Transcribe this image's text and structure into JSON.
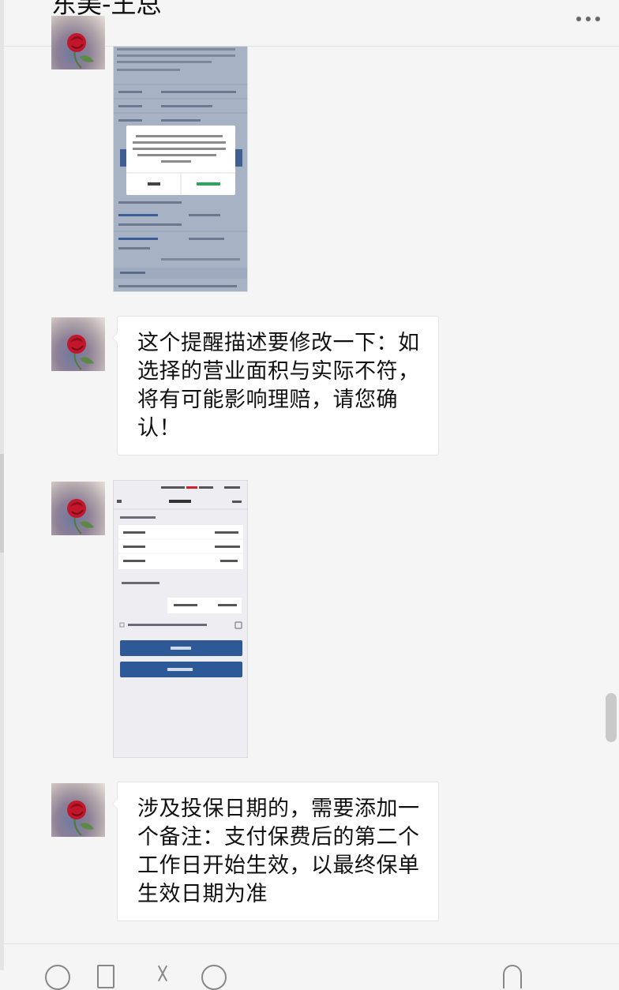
{
  "header": {
    "title": "东美-王总",
    "more_icon": "more-dots-icon"
  },
  "messages": [
    {
      "type": "image",
      "sender_avatar": "rose-avatar",
      "description_icon": "screenshot-thumbnail"
    },
    {
      "type": "text",
      "sender_avatar": "rose-avatar",
      "text": "这个提醒描述要修改一下：如选择的营业面积与实际不符，将有可能影响理赔，请您确认！"
    },
    {
      "type": "image",
      "sender_avatar": "rose-avatar",
      "description_icon": "screenshot-thumbnail"
    },
    {
      "type": "text",
      "sender_avatar": "rose-avatar",
      "text": "涉及投保日期的，需要添加一个备注：支付保费后的第二个工作日开始生效，以最终保单生效日期为准"
    }
  ],
  "toolbar": {
    "icons": [
      "emoji-icon",
      "file-icon",
      "scissors-icon",
      "chat-history-icon",
      "call-icon"
    ]
  },
  "colors": {
    "background": "#f5f5f5",
    "bubble": "#ffffff",
    "screenshot_button_blue": "#2d5a97",
    "screenshot_accent_green": "#27a85a"
  }
}
